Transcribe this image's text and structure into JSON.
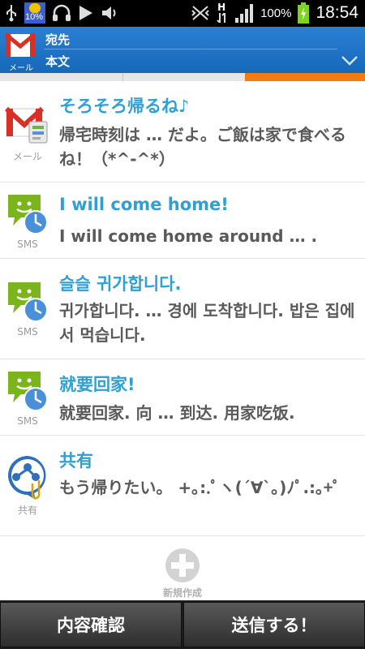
{
  "status_bar": {
    "time": "18:54",
    "battery_percent": "100%",
    "weather_label": "10%",
    "signal_label": "H",
    "icons": [
      "usb-icon",
      "weather-icon",
      "headset-icon",
      "play-icon",
      "volume-icon",
      "vibrate-icon",
      "data-icon",
      "signal-icon",
      "battery-icon"
    ]
  },
  "header": {
    "app_label": "メール",
    "to_label": "宛先",
    "body_label": "本文",
    "accent": "#2b7fd4"
  },
  "items": [
    {
      "icon": "gmail-icon",
      "caption": "メール",
      "title": "そろそろ帰るね♪",
      "body": "帰宅時刻は … だよ。ご飯は家で食べるね！（*^-^*）"
    },
    {
      "icon": "sms-icon",
      "caption": "SMS",
      "title": "I will come home!",
      "body": "I will come home around  … ."
    },
    {
      "icon": "sms-icon",
      "caption": "SMS",
      "title": "슬슬 귀가합니다.",
      "body": "귀가합니다.  …  경에 도착합니다. 밥은 집에서 먹습니다."
    },
    {
      "icon": "sms-icon",
      "caption": "SMS",
      "title": "就要回家!",
      "body": "就要回家. 向 … 到达. 用家吃饭."
    },
    {
      "icon": "share-icon",
      "caption": "共有",
      "title": "共有",
      "body": "もう帰りたい。 +｡:.ﾟヽ(´∀`｡)ﾉﾟ.:｡+ﾟ"
    }
  ],
  "new_button": {
    "label": "新規作成"
  },
  "bottom": {
    "confirm_label": "内容確認",
    "send_label": "送信する！"
  },
  "colors": {
    "title": "#2ea0d6",
    "body": "#5a5a5a",
    "tab_active": "#f07c13"
  }
}
